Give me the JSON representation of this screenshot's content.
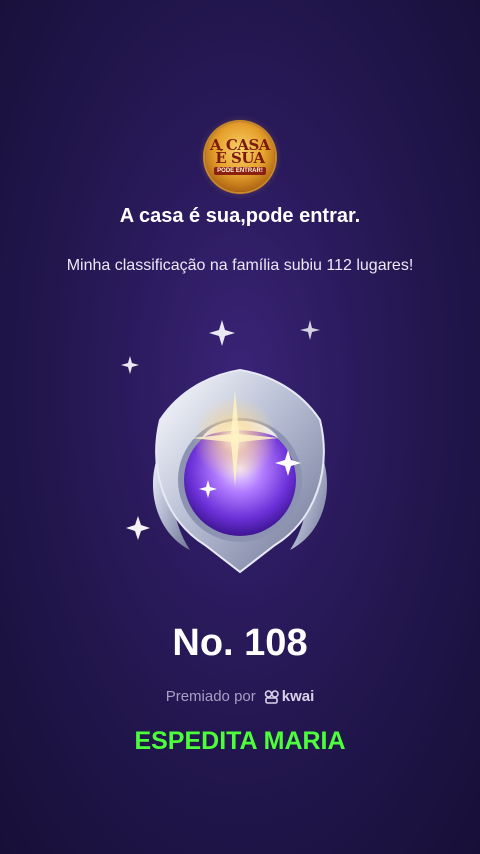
{
  "logo": {
    "line1": "A CASA",
    "line2": "É SUA",
    "tagline": "PODE ENTRAR!"
  },
  "title": "A casa é sua,pode entrar.",
  "subtitle": "Minha classificação na família subiu 112 lugares!",
  "rank": "No. 108",
  "awarded_by": {
    "label": "Premiado por",
    "brand": "kwai"
  },
  "recipient": "ESPEDITA MARIA",
  "colors": {
    "background": "#2a1a5c",
    "name": "#4dff3a",
    "muted": "#a89fc4"
  }
}
